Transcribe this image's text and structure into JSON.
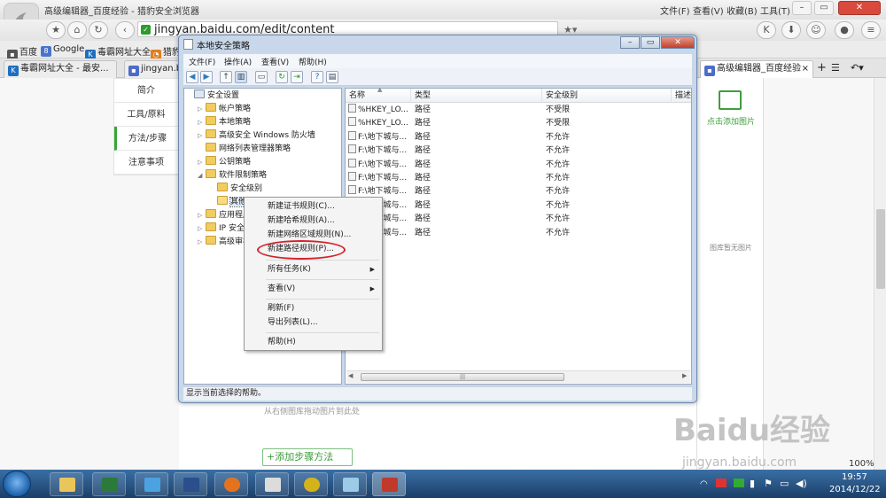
{
  "browser": {
    "window_title": "高级编辑器_百度经验 - 猎豹安全浏览器",
    "menus": [
      "文件(F)",
      "查看(V)",
      "收藏(B)",
      "工具(T)"
    ],
    "url": "jingyan.baidu.com/edit/content",
    "bookmarks": [
      "百度",
      "Google",
      "毒霸网址大全",
      "猎豹"
    ],
    "tabs": [
      "毒霸网址大全 - 最安...",
      "jingyan.ba",
      "高级编辑器_百度经验"
    ],
    "zoom": "100%"
  },
  "page": {
    "left_nav": [
      "简介",
      "工具/原料",
      "方法/步骤",
      "注意事项"
    ],
    "right_panel": {
      "add_image": "点击添加图片",
      "no_image": "图库暂无图片"
    },
    "drag_hint": "从右侧图库拖动图片到此处",
    "add_step": "+添加步骤方法"
  },
  "mmc": {
    "title": "本地安全策略",
    "menus": [
      "文件(F)",
      "操作(A)",
      "查看(V)",
      "帮助(H)"
    ],
    "tree": [
      {
        "label": "安全设置",
        "level": 0,
        "exp": "",
        "sel": false
      },
      {
        "label": "帐户策略",
        "level": 1,
        "exp": "▷",
        "sel": false
      },
      {
        "label": "本地策略",
        "level": 1,
        "exp": "▷",
        "sel": false
      },
      {
        "label": "高级安全 Windows 防火墙",
        "level": 1,
        "exp": "▷",
        "sel": false
      },
      {
        "label": "网络列表管理器策略",
        "level": 1,
        "exp": "",
        "sel": false
      },
      {
        "label": "公钥策略",
        "level": 1,
        "exp": "▷",
        "sel": false
      },
      {
        "label": "软件限制策略",
        "level": 1,
        "exp": "◢",
        "sel": false
      },
      {
        "label": "安全级别",
        "level": 2,
        "exp": "",
        "sel": false
      },
      {
        "label": "其他规则",
        "level": 2,
        "exp": "",
        "sel": true
      },
      {
        "label": "应用程序",
        "level": 1,
        "exp": "▷",
        "sel": false
      },
      {
        "label": "IP 安全策",
        "level": 1,
        "exp": "▷",
        "sel": false
      },
      {
        "label": "高级审核",
        "level": 1,
        "exp": "▷",
        "sel": false
      }
    ],
    "columns": [
      "名称",
      "类型",
      "安全级别",
      "描述"
    ],
    "rows": [
      [
        "%HKEY_LO...",
        "路径",
        "不受限"
      ],
      [
        "%HKEY_LO...",
        "路径",
        "不受限"
      ],
      [
        "F:\\地下城与...",
        "路径",
        "不允许"
      ],
      [
        "F:\\地下城与...",
        "路径",
        "不允许"
      ],
      [
        "F:\\地下城与...",
        "路径",
        "不允许"
      ],
      [
        "F:\\地下城与...",
        "路径",
        "不允许"
      ],
      [
        "F:\\地下城与...",
        "路径",
        "不允许"
      ],
      [
        "F:\\地下城与...",
        "路径",
        "不允许"
      ],
      [
        "F:\\地下城与...",
        "路径",
        "不允许"
      ],
      [
        "F:\\地下城与...",
        "路径",
        "不允许"
      ]
    ],
    "status": "显示当前选择的帮助。"
  },
  "context_menu": {
    "items": [
      "新建证书规则(C)...",
      "新建哈希规则(A)...",
      "新建网络区域规则(N)...",
      "新建路径规则(P)...",
      "所有任务(K)",
      "查看(V)",
      "刷新(F)",
      "导出列表(L)...",
      "帮助(H)"
    ],
    "highlighted": "新建路径规则(P)..."
  },
  "watermark": {
    "logo": "Baidu经验",
    "url": "jingyan.baidu.com"
  },
  "clock": {
    "time": "19:57",
    "date": "2014/12/22"
  },
  "colors": {
    "highlight_circle": "#d2232a",
    "taskbar": "#1b3f68",
    "baidu_green": "#3ca03c"
  }
}
